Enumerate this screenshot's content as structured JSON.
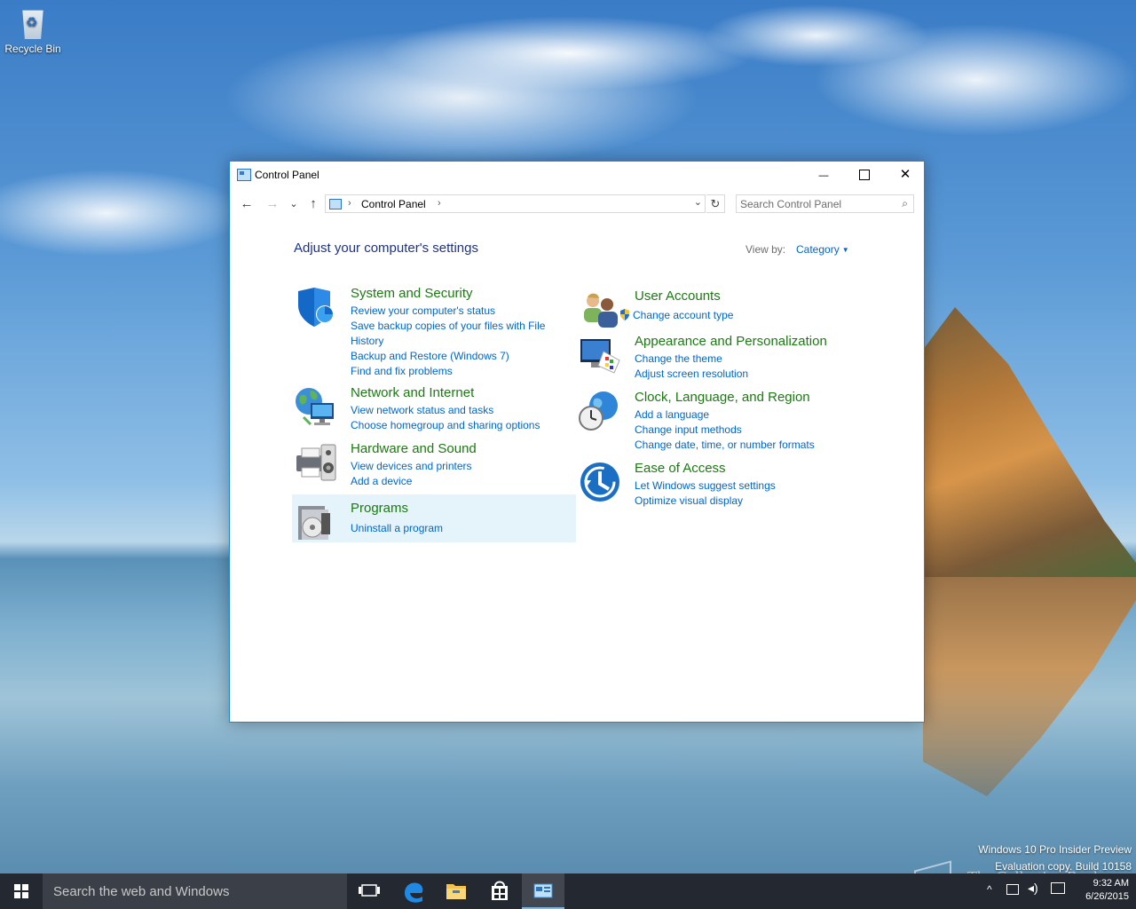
{
  "desktop": {
    "recycle_bin_label": "Recycle Bin",
    "watermark_line1": "Windows 10 Pro Insider Preview",
    "watermark_line2": "Evaluation copy. Build 10158",
    "logo_watermark": "The Collection Book"
  },
  "window": {
    "title": "Control Panel",
    "buttons": {
      "minimize": "—",
      "close": "✕"
    },
    "nav": {
      "back": "←",
      "forward": "→",
      "recent": "⌄",
      "up": "↑",
      "breadcrumb": "Control Panel",
      "dropdown": "⌄",
      "refresh": "↻"
    },
    "search": {
      "placeholder": "Search Control Panel",
      "value": ""
    }
  },
  "content": {
    "heading": "Adjust your computer's settings",
    "view_by_label": "View by:",
    "view_by_value": "Category"
  },
  "categories": {
    "system": {
      "title": "System and Security",
      "icon": "shield-icon",
      "links": [
        "Review your computer's status",
        "Save backup copies of your files with File History",
        "Backup and Restore (Windows 7)",
        "Find and fix problems"
      ]
    },
    "network": {
      "title": "Network and Internet",
      "icon": "network-globe-icon",
      "links": [
        "View network status and tasks",
        "Choose homegroup and sharing options"
      ]
    },
    "hardware": {
      "title": "Hardware and Sound",
      "icon": "printer-speaker-icon",
      "links": [
        "View devices and printers",
        "Add a device"
      ]
    },
    "programs": {
      "title": "Programs",
      "icon": "programs-disc-icon",
      "links": [
        "Uninstall a program"
      ]
    },
    "users": {
      "title": "User Accounts",
      "icon": "users-icon",
      "links": [
        "Change account type"
      ]
    },
    "appearance": {
      "title": "Appearance and Personalization",
      "icon": "monitor-palette-icon",
      "links": [
        "Change the theme",
        "Adjust screen resolution"
      ]
    },
    "clock": {
      "title": "Clock, Language, and Region",
      "icon": "clock-globe-icon",
      "links": [
        "Add a language",
        "Change input methods",
        "Change date, time, or number formats"
      ]
    },
    "ease": {
      "title": "Ease of Access",
      "icon": "ease-of-access-icon",
      "links": [
        "Let Windows suggest settings",
        "Optimize visual display"
      ]
    }
  },
  "taskbar": {
    "search_placeholder": "Search the web and Windows",
    "time": "9:32 AM",
    "date": "6/26/2015"
  },
  "colors": {
    "accent": "#1c87d6",
    "category_title": "#1c7a12",
    "link": "#0066cc",
    "heading": "#1e3287"
  }
}
